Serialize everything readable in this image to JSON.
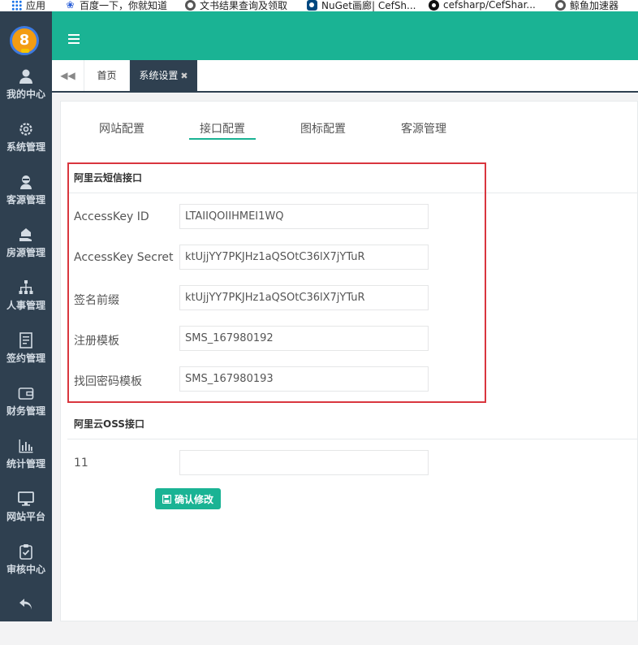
{
  "bookmarks": [
    {
      "label": "应用",
      "icon": "apps-grid-icon"
    },
    {
      "label": "百度一下，你就知道",
      "icon": "baidu-paw-icon"
    },
    {
      "label": "文书结果查询及领取",
      "icon": "globe-icon"
    },
    {
      "label": "NuGet画廊| CefSh...",
      "icon": "nuget-icon"
    },
    {
      "label": "cefsharp/CefShar...",
      "icon": "github-icon"
    },
    {
      "label": "鲸鱼加速器",
      "icon": "globe-icon"
    }
  ],
  "logo": {
    "text": "8"
  },
  "sidebar": {
    "items": [
      {
        "label": "我的中心",
        "icon": "user-icon"
      },
      {
        "label": "系统管理",
        "icon": "gear-icon"
      },
      {
        "label": "客源管理",
        "icon": "customer-icon"
      },
      {
        "label": "房源管理",
        "icon": "house-hand-icon"
      },
      {
        "label": "人事管理",
        "icon": "org-chart-icon"
      },
      {
        "label": "签约管理",
        "icon": "contract-icon"
      },
      {
        "label": "财务管理",
        "icon": "wallet-icon"
      },
      {
        "label": "统计管理",
        "icon": "bar-chart-icon"
      },
      {
        "label": "网站平台",
        "icon": "monitor-icon"
      },
      {
        "label": "审核中心",
        "icon": "checklist-icon"
      },
      {
        "label": "",
        "icon": "back-arrow-icon"
      }
    ]
  },
  "tabs": {
    "home": "首页",
    "active": "系统设置",
    "close_glyph": "✖"
  },
  "subtabs": [
    "网站配置",
    "接口配置",
    "图标配置",
    "客源管理"
  ],
  "active_subtab": "接口配置",
  "sms_section": {
    "title": "阿里云短信接口",
    "fields": [
      {
        "label": "AccessKey ID",
        "value": "LTAIIQOIIHMEI1WQ"
      },
      {
        "label": "AccessKey Secret",
        "value": "ktUjjYY7PKJHz1aQSOtC36lX7jYTuR"
      },
      {
        "label": "签名前缀",
        "value": "ktUjjYY7PKJHz1aQSOtC36lX7jYTuR"
      },
      {
        "label": "注册模板",
        "value": "SMS_167980192"
      },
      {
        "label": "找回密码模板",
        "value": "SMS_167980193"
      }
    ]
  },
  "oss_section": {
    "title": "阿里云OSS接口",
    "fields": [
      {
        "label": "11",
        "value": ""
      }
    ]
  },
  "confirm_button": "确认修改",
  "colors": {
    "primary": "#1ab394",
    "sidebar": "#2f4050",
    "highlight": "#d9363e"
  }
}
